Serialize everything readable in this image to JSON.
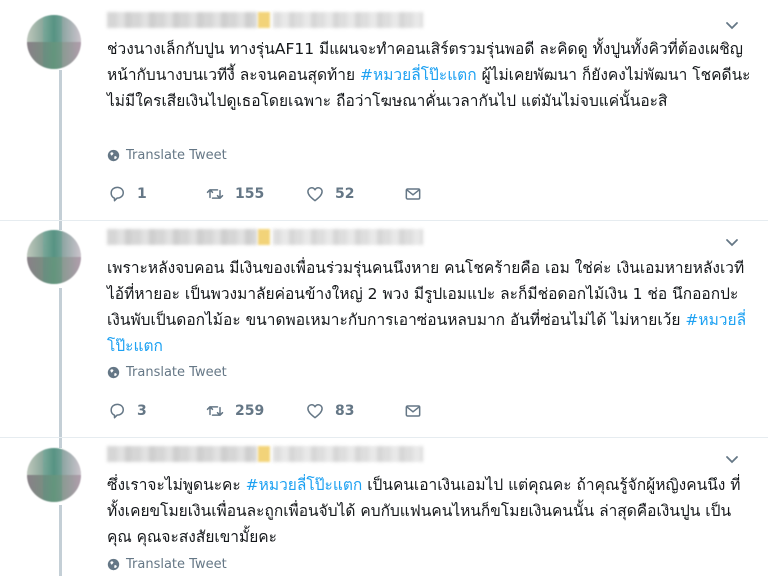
{
  "tweets": [
    {
      "text_before": "ช่วงนางเล็กกับปูน ทางรุ่นAF11 มีแผนจะทำคอนเสิร์ตรวมรุ่นพอดี ละคิดดู ทั้งปูนทั้งคิวที่ต้องเผชิญหน้ากับนางบนเวทีงี้ ละจนคอนสุดท้าย ",
      "hashtag": "#หมวยลี่โป๊ะแตก",
      "text_after": " ผู้ไม่เคยพัฒนา ก็ยังคงไม่พัฒนา โชคดีนะ ไม่มีใครเสียเงินไปดูเธอโดยเฉพาะ ถือว่าโฆษณาคั่นเวลากันไป แต่มันไม่จบแค่นั้นอะสิ",
      "translate_label": "Translate Tweet",
      "replies": "1",
      "retweets": "155",
      "likes": "52"
    },
    {
      "text_before": "เพราะหลังจบคอน มีเงินของเพื่อนร่วมรุ่นคนนึงหาย คนโชคร้ายคือ เอม ใช่ค่ะ เงินเอมหายหลังเวที ไอ้ที่หายอะ เป็นพวงมาลัยค่อนข้างใหญ่ 2 พวง มีรูปเอมแปะ ละก็มีช่อดอกไม้เงิน 1 ช่อ นึกออกปะ เงินพับเป็นดอกไม้อะ ขนาดพอเหมาะกับการเอาซ่อนหลบมาก อันที่ซ่อนไม่ได้ ไม่หายเว้ย ",
      "hashtag": "#หมวยลี่โป๊ะแตก",
      "text_after": "",
      "translate_label": "Translate Tweet",
      "replies": "3",
      "retweets": "259",
      "likes": "83"
    },
    {
      "text_before": "ซึ่งเราจะไม่พูดนะคะ ",
      "hashtag": "#หมวยลี่โป๊ะแตก",
      "text_after": " เป็นคนเอาเงินเอมไป แต่คุณคะ ถ้าคุณรู้จักผู้หญิงคนนึง ที่ทั้งเคยขโมยเงินเพื่อนละถูกเพื่อนจับได้ คบกับแฟนคนไหนก็ขโมยเงินคนนั้น ล่าสุดคือเงินปูน เป็นคุณ คุณจะสงสัยเขามั้ยคะ",
      "translate_label": "Translate Tweet"
    }
  ],
  "colors": {
    "hashtag": "#1da1f2",
    "meta": "#657786",
    "thread_line": "#c4cfd6",
    "border": "#e6ecf0"
  },
  "icons": [
    "chevron-down-icon",
    "globe-icon",
    "reply-icon",
    "retweet-icon",
    "heart-icon",
    "envelope-icon"
  ]
}
